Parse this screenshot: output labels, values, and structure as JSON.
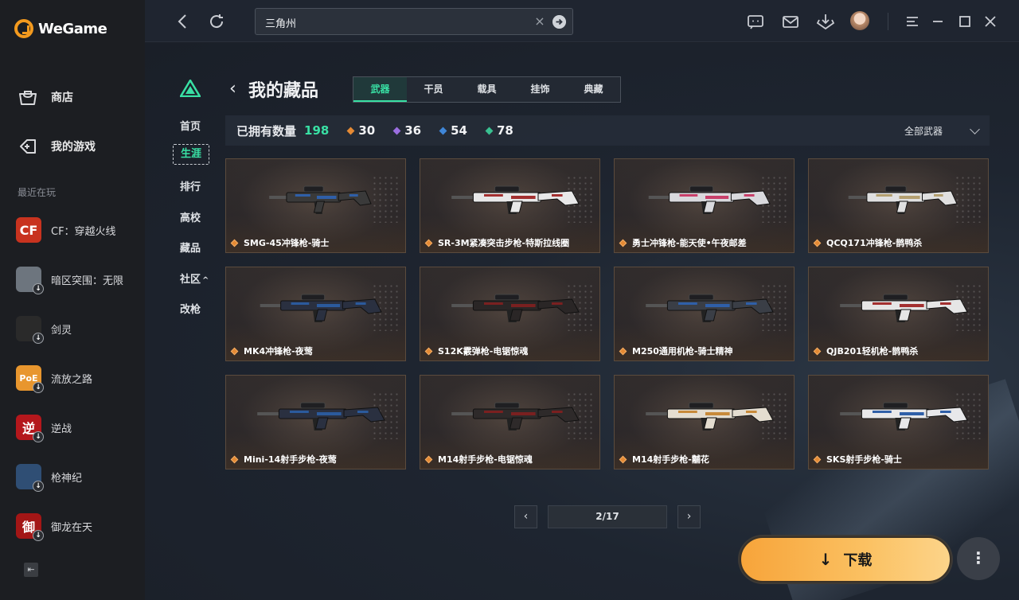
{
  "app": {
    "name": "WeGame"
  },
  "sidebar": {
    "store_label": "商店",
    "my_games_label": "我的游戏",
    "recent_label": "最近在玩",
    "recent_games": [
      {
        "name": "CF：穿越火线",
        "icon_text": "CF",
        "color": "#c8331f"
      },
      {
        "name": "暗区突围：无限",
        "icon_text": "",
        "color": "#6d757e"
      },
      {
        "name": "剑灵",
        "icon_text": "",
        "color": "#2a2a2a"
      },
      {
        "name": "流放之路",
        "icon_text": "PoE",
        "color": "#e8962e"
      },
      {
        "name": "逆战",
        "icon_text": "逆",
        "color": "#b4171c"
      },
      {
        "name": "枪神纪",
        "icon_text": "",
        "color": "#2f4e74"
      },
      {
        "name": "御龙在天",
        "icon_text": "御",
        "color": "#a31616"
      }
    ]
  },
  "topbar": {
    "search_value": "三角州",
    "search_clear": "×"
  },
  "subnav": {
    "items": [
      "首页",
      "生涯",
      "排行",
      "高校",
      "藏品",
      "社区",
      "改枪"
    ],
    "active": "生涯",
    "community_caret": "^"
  },
  "page": {
    "title": "我的藏品",
    "tabs": [
      "武器",
      "干员",
      "载具",
      "挂饰",
      "典藏"
    ],
    "active_tab": "武器"
  },
  "stats": {
    "owned_label": "已拥有数量",
    "owned_count": "198",
    "rarities": [
      {
        "value": "30",
        "color": "#e58a34"
      },
      {
        "value": "36",
        "color": "#9b6ee0"
      },
      {
        "value": "54",
        "color": "#3f86d8"
      },
      {
        "value": "78",
        "color": "#39c090"
      }
    ],
    "filter_label": "全部武器"
  },
  "collection": [
    {
      "name": "SMG-45冲锋枪-骑士",
      "accent": "#2f5fa8",
      "body": "#3a3a3a"
    },
    {
      "name": "SR-3M紧凑突击步枪-特斯拉线圈",
      "accent": "#a33030",
      "body": "#e8e8e8"
    },
    {
      "name": "勇士冲锋枪-能天使•午夜邮差",
      "accent": "#c8406a",
      "body": "#d9d9dd"
    },
    {
      "name": "QCQ171冲锋枪-鹊鸭杀",
      "accent": "#b4a070",
      "body": "#e0e0e0"
    },
    {
      "name": "MK4冲锋枪-夜莺",
      "accent": "#2b5a9c",
      "body": "#2a3040"
    },
    {
      "name": "S12K霰弹枪-电锯惊魂",
      "accent": "#7a2020",
      "body": "#2a2626"
    },
    {
      "name": "M250通用机枪-骑士精神",
      "accent": "#2f5fa8",
      "body": "#3a3e46"
    },
    {
      "name": "QJB201轻机枪-鹊鸭杀",
      "accent": "#a33030",
      "body": "#e6e6e6"
    },
    {
      "name": "Mini-14射手步枪-夜莺",
      "accent": "#2b5a9c",
      "body": "#2a3040"
    },
    {
      "name": "M14射手步枪-电锯惊魂",
      "accent": "#7a2020",
      "body": "#2e2a2a"
    },
    {
      "name": "M14射手步枪-黼花",
      "accent": "#c88a3a",
      "body": "#e4ddd0"
    },
    {
      "name": "SKS射手步枪-骑士",
      "accent": "#2f5fa8",
      "body": "#e8e8ea"
    }
  ],
  "pagination": {
    "prev": "‹",
    "next": "›",
    "indicator": "2/17"
  },
  "download": {
    "label": "下载",
    "arrow": "↓"
  },
  "more": {
    "label": "⋮"
  }
}
